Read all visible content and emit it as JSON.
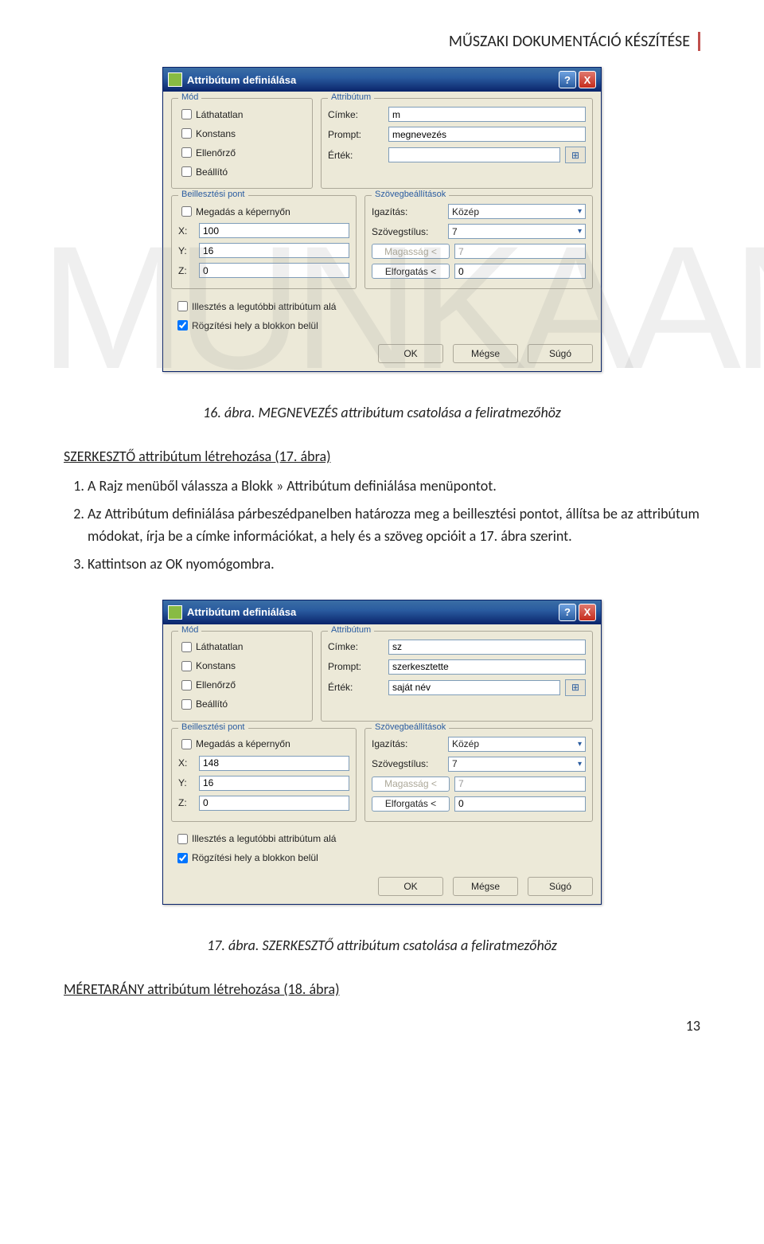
{
  "header": "MŰSZAKI DOKUMENTÁCIÓ KÉSZÍTÉSE",
  "watermark": "MUNKAANYAG",
  "page_number": "13",
  "dialog_common": {
    "title": "Attribútum definiálása",
    "groups": {
      "mod": "Mód",
      "attr": "Attribútum",
      "beill": "Beillesztési pont",
      "szov": "Szövegbeállítások"
    },
    "mod_options": [
      "Láthatatlan",
      "Konstans",
      "Ellenőrző",
      "Beállító"
    ],
    "attr_labels": {
      "cimke": "Címke:",
      "prompt": "Prompt:",
      "ertek": "Érték:"
    },
    "beill_specify": "Megadás a képernyőn",
    "xyz": [
      "X:",
      "Y:",
      "Z:"
    ],
    "szov_labels": {
      "igaz": "Igazítás:",
      "stilus": "Szövegstílus:",
      "mag": "Magasság <",
      "elf": "Elforgatás <"
    },
    "bottom_opts": [
      {
        "label": "Illesztés a legutóbbi attribútum alá",
        "checked": false
      },
      {
        "label": "Rögzítési hely a blokkon belül",
        "checked": true
      }
    ],
    "buttons": {
      "ok": "OK",
      "cancel": "Mégse",
      "help": "Súgó"
    }
  },
  "dialog1": {
    "attr": {
      "cimke": "m",
      "prompt": "megnevezés",
      "ertek": ""
    },
    "beill": {
      "x": "100",
      "y": "16",
      "z": "0"
    },
    "szov": {
      "igaz": "Közép",
      "stilus": "7",
      "mag": "7",
      "elf": "0"
    }
  },
  "dialog2": {
    "attr": {
      "cimke": "sz",
      "prompt": "szerkesztette",
      "ertek": "saját név"
    },
    "beill": {
      "x": "148",
      "y": "16",
      "z": "0"
    },
    "szov": {
      "igaz": "Közép",
      "stilus": "7",
      "mag": "7",
      "elf": "0"
    }
  },
  "caption1": "16. ábra. MEGNEVEZÉS attribútum csatolása a feliratmezőhöz",
  "para1": "SZERKESZTŐ attribútum létrehozása (17. ábra)",
  "list1": [
    "A Rajz menüből válassza a Blokk » Attribútum definiálása menüpontot.",
    "Az Attribútum definiálása párbeszédpanelben határozza meg a beillesztési pontot, állítsa be az attribútum módokat, írja be a címke információkat, a hely és a szöveg opcióit a 17. ábra szerint.",
    "Kattintson az OK nyomógombra."
  ],
  "caption2": "17. ábra. SZERKESZTŐ attribútum csatolása a feliratmezőhöz",
  "para2": "MÉRETARÁNY attribútum létrehozása (18. ábra)"
}
